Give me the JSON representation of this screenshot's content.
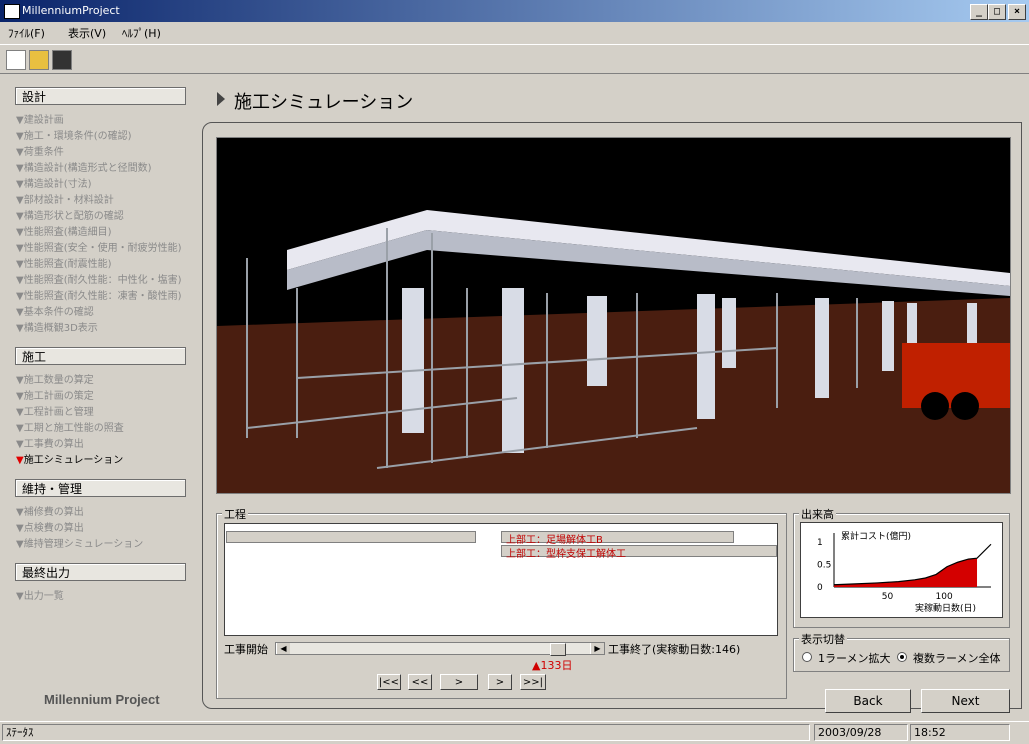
{
  "window": {
    "title": "MillenniumProject",
    "min": "_",
    "max": "□",
    "close": "×"
  },
  "menu": [
    "ﾌｧｲﾙ(F)",
    "表示(V)",
    "ﾍﾙﾌﾟ(H)"
  ],
  "toolbar": {
    "icons": [
      "new-file-icon",
      "open-folder-icon",
      "save-disk-icon"
    ]
  },
  "sidebar": {
    "sections": [
      {
        "label": "設計",
        "items": [
          "建設計画",
          "施工・環境条件(の確認)",
          "荷重条件",
          "構造設計(構造形式と径間数)",
          "構造設計(寸法)",
          "部材設計・材料設計",
          "構造形状と配筋の確認",
          "性能照査(構造細目)",
          "性能照査(安全・使用・耐疲労性能)",
          "性能照査(耐震性能)",
          "性能照査(耐久性能：中性化・塩害)",
          "性能照査(耐久性能：凍害・酸性雨)",
          "基本条件の確認",
          "構造概観3D表示"
        ]
      },
      {
        "label": "施工",
        "items": [
          "施工数量の算定",
          "施工計画の策定",
          "工程計画と管理",
          "工期と施工性能の照査",
          "工事費の算出",
          "施工シミュレーション"
        ]
      },
      {
        "label": "維持・管理",
        "items": [
          "補修費の算出",
          "点検費の算出",
          "維持管理シミュレーション"
        ]
      },
      {
        "label": "最終出力",
        "items": [
          "出力一覧"
        ]
      }
    ],
    "active": "施工シミュレーション",
    "brand": "Millennium Project"
  },
  "main": {
    "page_title": "施工シミュレーション",
    "schedule": {
      "group_label": "工程",
      "bar1_label": "上部工：足場解体工B",
      "bar2_label": "上部工：型枠支保工解体工",
      "start_label": "工事開始",
      "end_label": "工事終了(実稼動日数:146)",
      "marker": "▲133日",
      "progress_fraction": 0.91,
      "nav_buttons": [
        "|<<",
        "<<",
        ">",
        ">",
        ">>|"
      ]
    },
    "output": {
      "group_label": "出来高",
      "chart_data": {
        "type": "area",
        "title": "累計コスト(億円)",
        "xlabel": "実稼動日数(日)",
        "ylabel": "",
        "x_ticks": [
          "50",
          "100"
        ],
        "y_ticks": [
          "0",
          "0.5",
          "1"
        ],
        "xlim": [
          0,
          146
        ],
        "ylim": [
          0,
          1.2
        ],
        "x": [
          0,
          20,
          40,
          60,
          75,
          85,
          95,
          105,
          115,
          125,
          133,
          146
        ],
        "y": [
          0.05,
          0.07,
          0.09,
          0.12,
          0.16,
          0.2,
          0.28,
          0.45,
          0.55,
          0.62,
          0.64,
          0.95
        ],
        "fill_until_x": 133,
        "fill_color": "#d40000"
      }
    },
    "display_toggle": {
      "group_label": "表示切替",
      "option1": "1ラーメン拡大",
      "option2": "複数ラーメン全体",
      "selected": "複数ラーメン全体"
    },
    "buttons": {
      "back": "Back",
      "next": "Next"
    }
  },
  "status": {
    "text": "ｽﾃｰﾀｽ",
    "date": "2003/09/28",
    "time": "18:52"
  }
}
